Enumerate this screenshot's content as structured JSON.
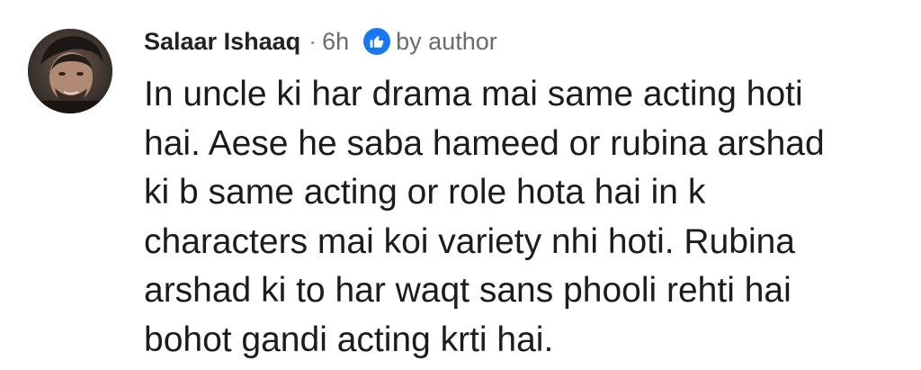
{
  "comment": {
    "author": "Salaar Ishaaq",
    "separator": "·",
    "time": "6h",
    "reaction_icon": "thumbs-up-icon",
    "reaction_color": "#1877f2",
    "reaction_label": "by author",
    "body_lines": [
      "In uncle ki har drama mai same acting hoti",
      "hai. Aese he saba hameed or rubina arshad",
      "ki b same acting or role hota hai in k",
      "characters mai koi variety nhi hoti. Rubina",
      "arshad ki to har waqt sans phooli rehti hai",
      "bohot gandi acting krti hai."
    ]
  }
}
